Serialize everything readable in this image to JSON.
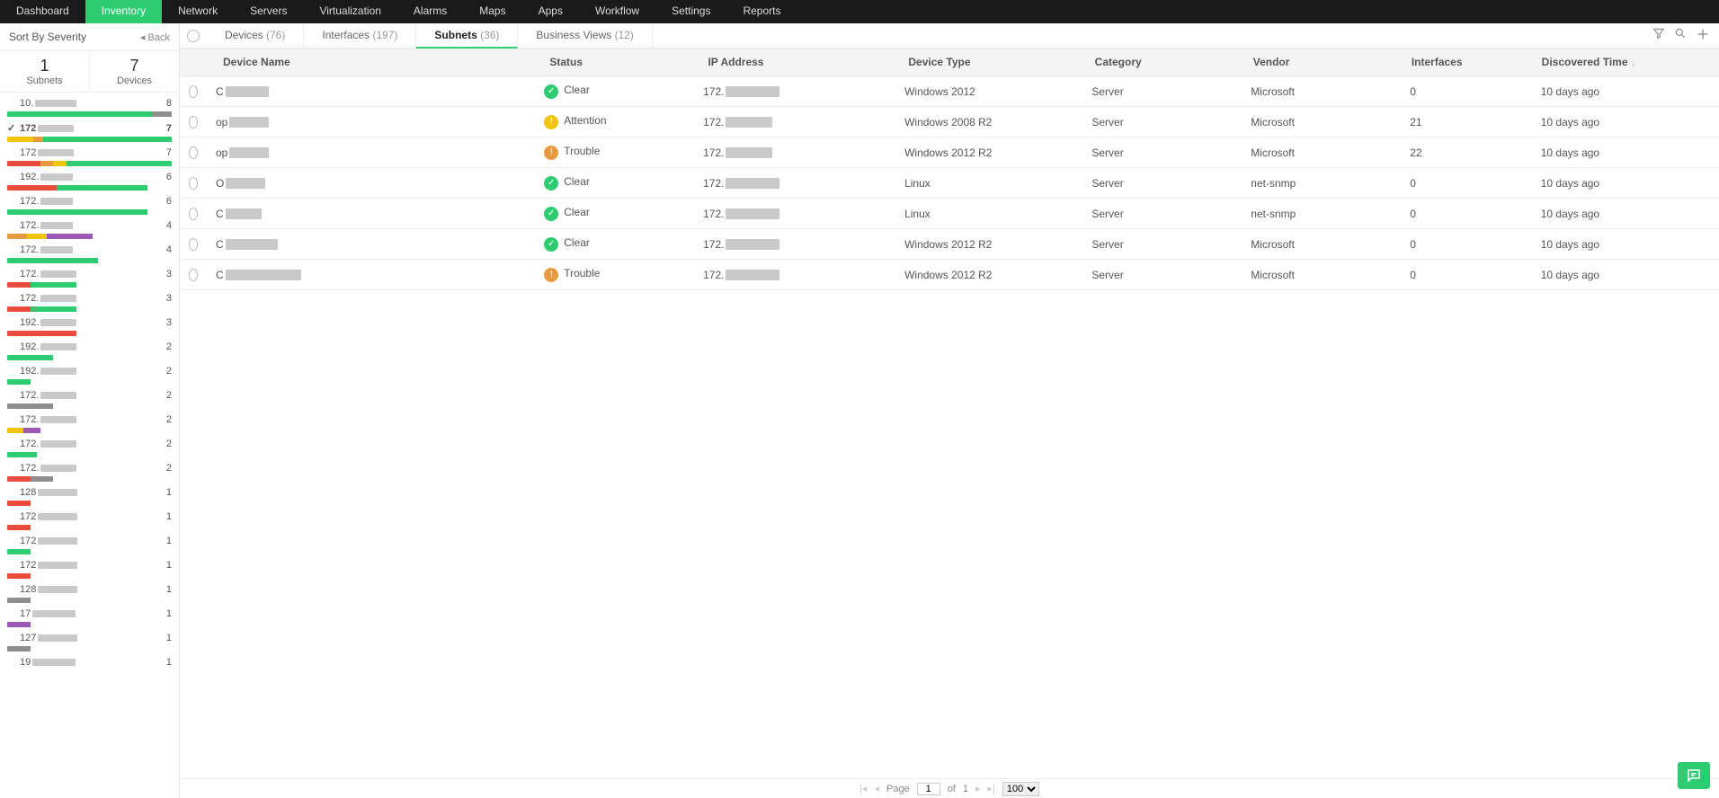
{
  "nav": {
    "items": [
      "Dashboard",
      "Inventory",
      "Network",
      "Servers",
      "Virtualization",
      "Alarms",
      "Maps",
      "Apps",
      "Workflow",
      "Settings",
      "Reports"
    ],
    "active": 1
  },
  "sidebar": {
    "sort_label": "Sort By Severity",
    "back": "Back",
    "counters": [
      {
        "num": "1",
        "lbl": "Subnets"
      },
      {
        "num": "7",
        "lbl": "Devices"
      }
    ],
    "selected": 1,
    "subnets": [
      {
        "pfx": "10.",
        "mw": 46,
        "cnt": "8",
        "bar": [
          [
            "#2ecc71",
            88
          ],
          [
            "#8e8e8e",
            12
          ]
        ]
      },
      {
        "pfx": "172",
        "mw": 40,
        "cnt": "7",
        "bar": [
          [
            "#f1c40f",
            16
          ],
          [
            "#e69c3e",
            6
          ],
          [
            "#2ecc71",
            78
          ]
        ]
      },
      {
        "pfx": "172",
        "mw": 40,
        "cnt": "7",
        "bar": [
          [
            "#e74c3c",
            20
          ],
          [
            "#e69c3e",
            8
          ],
          [
            "#f1c40f",
            8
          ],
          [
            "#2ecc71",
            64
          ]
        ]
      },
      {
        "pfx": "192.",
        "mw": 36,
        "cnt": "6",
        "bar": [
          [
            "#e74c3c",
            30
          ],
          [
            "#2ecc71",
            55
          ]
        ]
      },
      {
        "pfx": "172.",
        "mw": 36,
        "cnt": "6",
        "bar": [
          [
            "#2ecc71",
            85
          ]
        ]
      },
      {
        "pfx": "172.",
        "mw": 36,
        "cnt": "4",
        "bar": [
          [
            "#e69c3e",
            12
          ],
          [
            "#f1c40f",
            12
          ],
          [
            "#9b59b6",
            28
          ]
        ]
      },
      {
        "pfx": "172.",
        "mw": 36,
        "cnt": "4",
        "bar": [
          [
            "#2ecc71",
            55
          ]
        ]
      },
      {
        "pfx": "172.",
        "mw": 40,
        "cnt": "3",
        "bar": [
          [
            "#e74c3c",
            14
          ],
          [
            "#2ecc71",
            28
          ]
        ]
      },
      {
        "pfx": "172.",
        "mw": 40,
        "cnt": "3",
        "bar": [
          [
            "#e74c3c",
            14
          ],
          [
            "#2ecc71",
            28
          ]
        ]
      },
      {
        "pfx": "192.",
        "mw": 40,
        "cnt": "3",
        "bar": [
          [
            "#e74c3c",
            42
          ]
        ]
      },
      {
        "pfx": "192.",
        "mw": 40,
        "cnt": "2",
        "bar": [
          [
            "#2ecc71",
            28
          ]
        ]
      },
      {
        "pfx": "192.",
        "mw": 40,
        "cnt": "2",
        "bar": [
          [
            "#2ecc71",
            14
          ]
        ]
      },
      {
        "pfx": "172.",
        "mw": 40,
        "cnt": "2",
        "bar": [
          [
            "#8e8e8e",
            28
          ]
        ]
      },
      {
        "pfx": "172.",
        "mw": 40,
        "cnt": "2",
        "bar": [
          [
            "#f1c40f",
            10
          ],
          [
            "#9b59b6",
            10
          ]
        ]
      },
      {
        "pfx": "172.",
        "mw": 40,
        "cnt": "2",
        "bar": [
          [
            "#2ecc71",
            18
          ]
        ]
      },
      {
        "pfx": "172.",
        "mw": 40,
        "cnt": "2",
        "bar": [
          [
            "#e74c3c",
            14
          ],
          [
            "#8e8e8e",
            14
          ]
        ]
      },
      {
        "pfx": "128",
        "mw": 44,
        "cnt": "1",
        "bar": [
          [
            "#e74c3c",
            14
          ]
        ]
      },
      {
        "pfx": "172",
        "mw": 44,
        "cnt": "1",
        "bar": [
          [
            "#e74c3c",
            14
          ]
        ]
      },
      {
        "pfx": "172",
        "mw": 44,
        "cnt": "1",
        "bar": [
          [
            "#2ecc71",
            14
          ]
        ]
      },
      {
        "pfx": "172",
        "mw": 44,
        "cnt": "1",
        "bar": [
          [
            "#e74c3c",
            14
          ]
        ]
      },
      {
        "pfx": "128",
        "mw": 44,
        "cnt": "1",
        "bar": [
          [
            "#8e8e8e",
            14
          ]
        ]
      },
      {
        "pfx": "17",
        "mw": 48,
        "cnt": "1",
        "bar": [
          [
            "#9b59b6",
            14
          ]
        ]
      },
      {
        "pfx": "127",
        "mw": 44,
        "cnt": "1",
        "bar": [
          [
            "#8e8e8e",
            14
          ]
        ]
      },
      {
        "pfx": "19",
        "mw": 48,
        "cnt": "1",
        "bar": []
      }
    ]
  },
  "tabs": [
    {
      "lbl": "Devices",
      "cnt": "(76)"
    },
    {
      "lbl": "Interfaces",
      "cnt": "(197)"
    },
    {
      "lbl": "Subnets",
      "cnt": "(36)"
    },
    {
      "lbl": "Business Views",
      "cnt": "(12)"
    }
  ],
  "tabs_active": 2,
  "columns": [
    "Device Name",
    "Status",
    "IP Address",
    "Device Type",
    "Category",
    "Vendor",
    "Interfaces",
    "Discovered Time"
  ],
  "rows": [
    {
      "npfx": "C",
      "nmw": 48,
      "status": "Clear",
      "sc": "s-clear",
      "ipmw": 60,
      "type": "Windows 2012",
      "cat": "Server",
      "vendor": "Microsoft",
      "ifc": "0",
      "disc": "10 days ago"
    },
    {
      "npfx": "op",
      "nmw": 44,
      "status": "Attention",
      "sc": "s-attn",
      "ipmw": 52,
      "type": "Windows 2008 R2",
      "cat": "Server",
      "vendor": "Microsoft",
      "ifc": "21",
      "disc": "10 days ago"
    },
    {
      "npfx": "op",
      "nmw": 44,
      "status": "Trouble",
      "sc": "s-trbl",
      "ipmw": 52,
      "type": "Windows 2012 R2",
      "cat": "Server",
      "vendor": "Microsoft",
      "ifc": "22",
      "disc": "10 days ago"
    },
    {
      "npfx": "O",
      "nmw": 44,
      "status": "Clear",
      "sc": "s-clear",
      "ipmw": 60,
      "type": "Linux",
      "cat": "Server",
      "vendor": "net-snmp",
      "ifc": "0",
      "disc": "10 days ago"
    },
    {
      "npfx": "C",
      "nmw": 40,
      "status": "Clear",
      "sc": "s-clear",
      "ipmw": 60,
      "type": "Linux",
      "cat": "Server",
      "vendor": "net-snmp",
      "ifc": "0",
      "disc": "10 days ago"
    },
    {
      "npfx": "C",
      "nmw": 58,
      "status": "Clear",
      "sc": "s-clear",
      "ipmw": 60,
      "type": "Windows 2012 R2",
      "cat": "Server",
      "vendor": "Microsoft",
      "ifc": "0",
      "disc": "10 days ago"
    },
    {
      "npfx": "C",
      "nmw": 84,
      "status": "Trouble",
      "sc": "s-trbl",
      "ipmw": 60,
      "type": "Windows 2012 R2",
      "cat": "Server",
      "vendor": "Microsoft",
      "ifc": "0",
      "disc": "10 days ago"
    }
  ],
  "ip_pfx": "172.",
  "footer": {
    "page_lbl": "Page",
    "page_val": "1",
    "of_lbl": "of",
    "total": "1",
    "per": "100"
  },
  "status_glyph": {
    "Clear": "✓",
    "Attention": "!",
    "Trouble": "!"
  }
}
